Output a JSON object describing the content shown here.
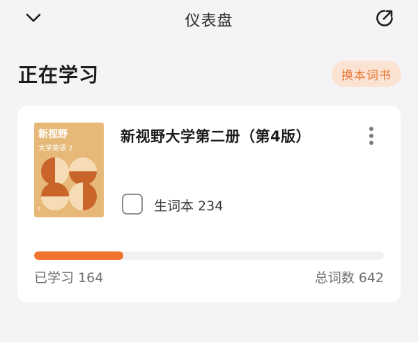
{
  "header": {
    "title": "仪表盘",
    "collapse_icon": "chevron-down-icon",
    "share_icon": "external-link-icon"
  },
  "section": {
    "title": "正在学习",
    "change_book_label": "换本词书"
  },
  "book": {
    "title": "新视野大学第二册（第4版）",
    "cover_title": "新视野",
    "cover_subtitle": "大学英语 2",
    "cover_number": "2",
    "vocab_label": "生词本 234",
    "vocab_checked": false,
    "learned_text": "已学习 164",
    "total_text": "总词数 642",
    "learned": 164,
    "total": 642
  },
  "colors": {
    "accent": "#f0742d",
    "accent_bg": "#fbe3d4",
    "cover": "#e7b979"
  }
}
